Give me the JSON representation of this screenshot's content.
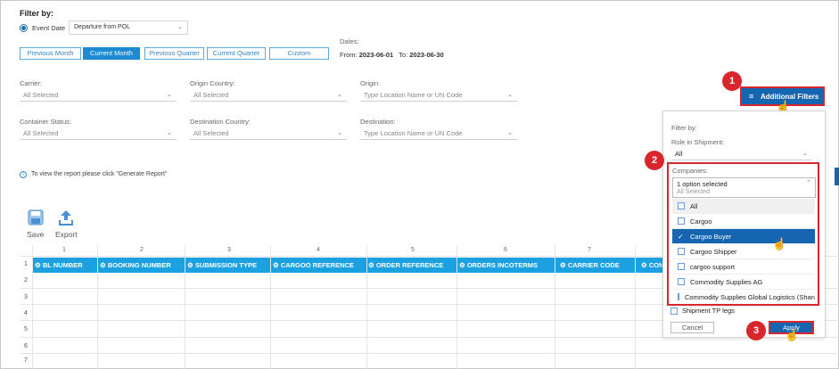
{
  "filter": {
    "title": "Filter by:",
    "event_date_label": "Event Date",
    "event_date_value": "Departure from POL",
    "periods": [
      "Previous Month",
      "Current Month",
      "Previous Quarter",
      "Current Quarter",
      "Custom"
    ],
    "active_period": "Current Month",
    "dates_label": "Dates:",
    "from_label": "From:",
    "from_value": "2023-06-01",
    "to_label": "To:",
    "to_value": "2023-06-30"
  },
  "fields": {
    "carrier": {
      "label": "Carrier:",
      "value": "All Selected"
    },
    "origin_country": {
      "label": "Origin Country:",
      "value": "All Selected"
    },
    "origin": {
      "label": "Origin:",
      "placeholder": "Type Location Name or UN Code"
    },
    "container_status": {
      "label": "Container Status:",
      "value": "All Selected"
    },
    "destination_country": {
      "label": "Destination Country:",
      "value": "All Selected"
    },
    "destination": {
      "label": "Destination:",
      "placeholder": "Type Location Name or UN Code"
    }
  },
  "info_text": "To view the report please click \"Generate Report\"",
  "toolbar": {
    "save_label": "Save",
    "export_label": "Export"
  },
  "grid": {
    "col_numbers": [
      "1",
      "2",
      "3",
      "4",
      "5",
      "6",
      "7"
    ],
    "row_numbers": [
      "1",
      "2",
      "3",
      "4",
      "5",
      "6",
      "7"
    ],
    "headers": [
      "BL NUMBER",
      "BOOKING NUMBER",
      "SUBMISSION TYPE",
      "CARGOO REFERENCE",
      "ORDER REFERENCE",
      "ORDERS INCOTERMS",
      "CARRIER CODE",
      "CONTAI"
    ]
  },
  "additional_filters": {
    "button_label": "Additional Filters",
    "filter_by": "Filter by:",
    "role_label": "Role in Shipment:",
    "role_value": "All",
    "companies_label": "Companies:",
    "companies_value": "1 option selected",
    "all_selected_hint": "All Selected",
    "options": [
      "All",
      "Cargoo",
      "Cargoo Buyer",
      "Cargoo Shipper",
      "cargoo support",
      "Commodity Supplies AG",
      "Commodity Supplies Global Logistics (Shang"
    ],
    "selected_option": "Cargoo Buyer",
    "shipment_tp_legs": "Shipment TP legs",
    "cancel_label": "Cancel",
    "apply_label": "Apply"
  },
  "badges": [
    "1",
    "2",
    "3"
  ],
  "colors": {
    "accent": "#1d8ad1",
    "header_bg": "#1ba1e2",
    "highlight": "#d9262c",
    "selected": "#1565b0"
  }
}
